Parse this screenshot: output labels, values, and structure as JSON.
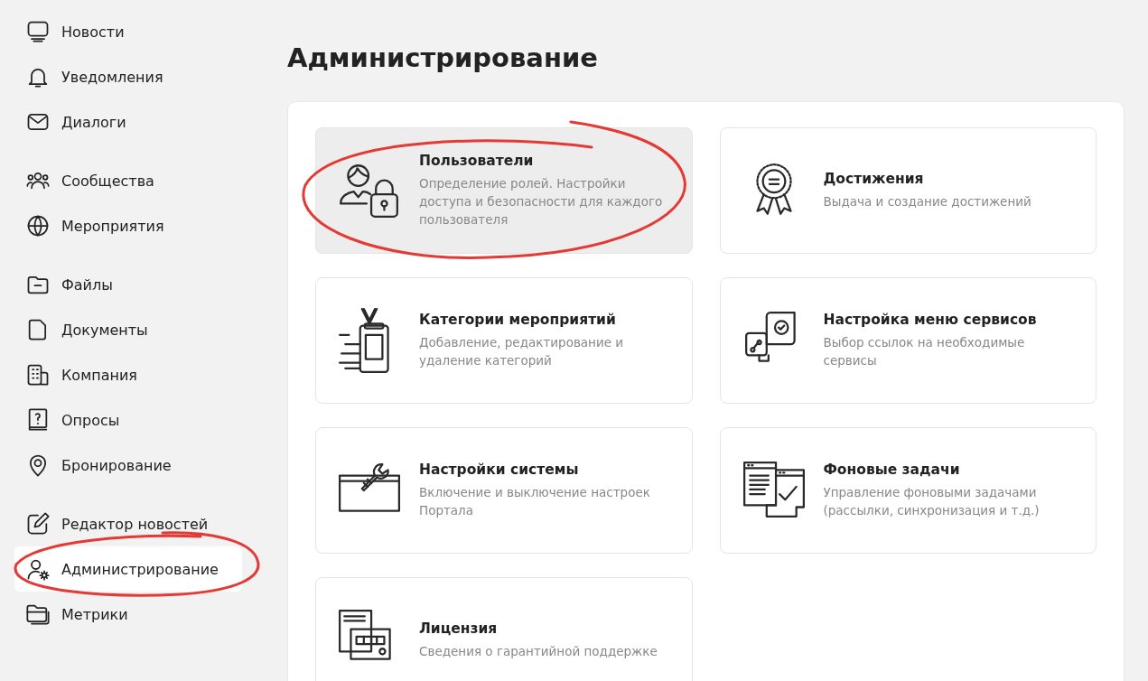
{
  "sidebar": {
    "groups": [
      {
        "items": [
          {
            "label": "Новости",
            "selected": false
          },
          {
            "label": "Уведомления",
            "selected": false
          },
          {
            "label": "Диалоги",
            "selected": false
          }
        ]
      },
      {
        "items": [
          {
            "label": "Сообщества",
            "selected": false
          },
          {
            "label": "Мероприятия",
            "selected": false
          }
        ]
      },
      {
        "items": [
          {
            "label": "Файлы",
            "selected": false
          },
          {
            "label": "Документы",
            "selected": false
          },
          {
            "label": "Компания",
            "selected": false
          },
          {
            "label": "Опросы",
            "selected": false
          },
          {
            "label": "Бронирование",
            "selected": false
          }
        ]
      },
      {
        "items": [
          {
            "label": "Редактор новостей",
            "selected": false
          },
          {
            "label": "Администрирование",
            "selected": true
          },
          {
            "label": "Метрики",
            "selected": false
          }
        ]
      }
    ]
  },
  "page": {
    "title": "Администрирование",
    "cards": [
      {
        "title": "Пользователи",
        "description": "Определение ролей. Настройки доступа и безопасности для каждого пользователя",
        "selected": true
      },
      {
        "title": "Достижения",
        "description": "Выдача и создание достижений",
        "selected": false
      },
      {
        "title": "Категории мероприятий",
        "description": "Добавление, редактирование и удаление категорий",
        "selected": false
      },
      {
        "title": "Настройка меню сервисов",
        "description": "Выбор ссылок на необходимые сервисы",
        "selected": false
      },
      {
        "title": "Настройки системы",
        "description": "Включение и выключение настроек Портала",
        "selected": false
      },
      {
        "title": "Фоновые задачи",
        "description": "Управление фоновыми задачами (рассылки, синхронизация и т.д.)",
        "selected": false
      },
      {
        "title": "Лицензия",
        "description": "Сведения о гарантийной поддержке",
        "selected": false
      }
    ]
  }
}
